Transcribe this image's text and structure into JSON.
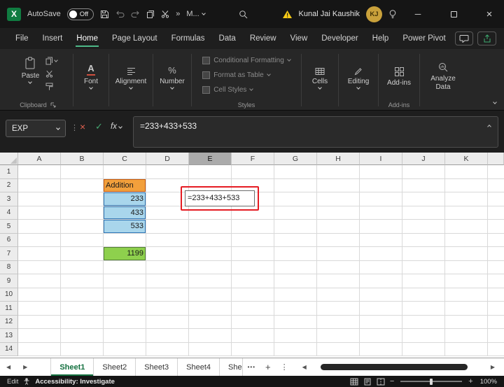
{
  "titlebar": {
    "autosave_label": "AutoSave",
    "autosave_state": "Off",
    "more_commands": "M...",
    "user_name": "Kunal Jai Kaushik",
    "user_initials": "KJ"
  },
  "menubar": {
    "tabs": [
      "File",
      "Insert",
      "Home",
      "Page Layout",
      "Formulas",
      "Data",
      "Review",
      "View",
      "Developer",
      "Help",
      "Power Pivot"
    ],
    "active_tab": "Home"
  },
  "ribbon": {
    "paste": "Paste",
    "font": "Font",
    "alignment": "Alignment",
    "number": "Number",
    "styles_items": [
      "Conditional Formatting",
      "Format as Table",
      "Cell Styles"
    ],
    "cells": "Cells",
    "editing": "Editing",
    "addins_button": "Add-ins",
    "analyze_button": "Analyze Data",
    "group_clipboard": "Clipboard",
    "group_styles": "Styles",
    "group_addins": "Add-ins"
  },
  "formula_bar": {
    "name_box": "EXP",
    "fx": "fx",
    "formula": "=233+433+533"
  },
  "grid": {
    "columns": [
      "A",
      "B",
      "C",
      "D",
      "E",
      "F",
      "G",
      "H",
      "I",
      "J",
      "K"
    ],
    "selected_column": "E",
    "row_count": 14,
    "cells": [
      {
        "ref": "C2",
        "text": "Addition",
        "bg": "#F2A03C",
        "border": "#C55A11",
        "align": "left"
      },
      {
        "ref": "C3",
        "text": "233",
        "bg": "#A9D6EC",
        "border": "#2E75B6",
        "align": "right"
      },
      {
        "ref": "C4",
        "text": "433",
        "bg": "#A9D6EC",
        "border": "#2E75B6",
        "align": "right"
      },
      {
        "ref": "C5",
        "text": "533",
        "bg": "#A9D6EC",
        "border": "#2E75B6",
        "align": "right"
      },
      {
        "ref": "C7",
        "text": "1199",
        "bg": "#8ED04D",
        "border": "#538135",
        "align": "right"
      }
    ],
    "edit_cell": {
      "ref": "E3",
      "text": "=233+433+533"
    }
  },
  "sheet_tabs": {
    "tabs": [
      "Sheet1",
      "Sheet2",
      "Sheet3",
      "Sheet4",
      "She"
    ],
    "active": "Sheet1"
  },
  "status_bar": {
    "mode": "Edit",
    "accessibility": "Accessibility: Investigate",
    "zoom": "100%"
  },
  "icons": {
    "excel_logo": "X",
    "quick_more": "»",
    "nav_left": "◀",
    "nav_right": "▶",
    "tab_more": "•••",
    "new_sheet": "+",
    "divider_dots": "⋮",
    "cancel": "×",
    "enter": "✓",
    "percent": "%",
    "font_letter": "A",
    "minimize": "─",
    "close": "×",
    "zoom_out": "−",
    "zoom_in": "+"
  }
}
